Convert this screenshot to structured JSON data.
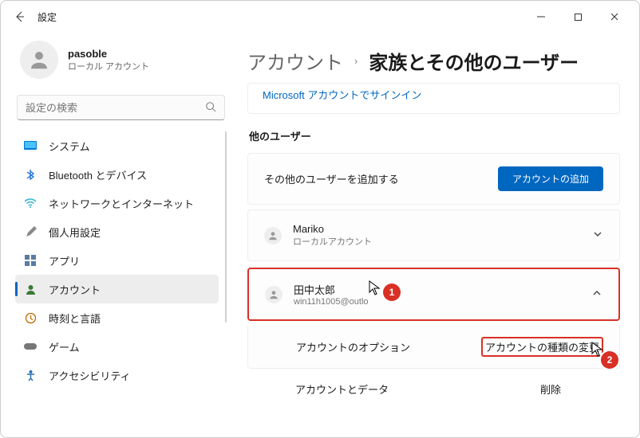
{
  "window": {
    "title": "設定"
  },
  "user": {
    "name": "pasoble",
    "subtitle": "ローカル アカウント"
  },
  "search": {
    "placeholder": "設定の検索"
  },
  "nav": {
    "system": "システム",
    "bluetooth": "Bluetooth とデバイス",
    "network": "ネットワークとインターネット",
    "personalization": "個人用設定",
    "apps": "アプリ",
    "accounts": "アカウント",
    "time": "時刻と言語",
    "gaming": "ゲーム",
    "accessibility": "アクセシビリティ"
  },
  "breadcrumb": {
    "parent": "アカウント",
    "current": "家族とその他のユーザー"
  },
  "ms_signin_link": "Microsoft アカウントでサインイン",
  "section_other_users": "他のユーザー",
  "add_other_user_label": "その他のユーザーを追加する",
  "add_account_btn": "アカウントの追加",
  "users": {
    "mariko": {
      "name": "Mariko",
      "sub": "ローカルアカウント"
    },
    "tanaka": {
      "name": "田中太郎",
      "sub": "win11h1005@outlo"
    }
  },
  "options": {
    "account_options": "アカウントのオプション",
    "change_account_type": "アカウントの種類の変更",
    "account_and_data": "アカウントとデータ",
    "remove": "削除"
  },
  "annotations": {
    "b1": "1",
    "b2": "2"
  }
}
